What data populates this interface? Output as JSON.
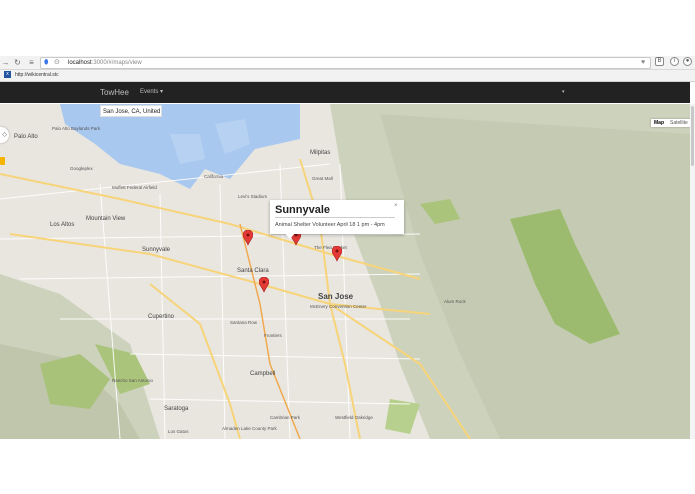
{
  "browser": {
    "url_host": "localhost",
    "url_path": ":3000/#/maps/view",
    "bookmark_label": "http://wikicentral.stc"
  },
  "navbar": {
    "brand": "TowHee",
    "events_label": "Events",
    "events_caret": "▾",
    "right_caret": "▾"
  },
  "map": {
    "search_value": "San Jose, CA, United S",
    "map_type_map": "Map",
    "map_type_satellite": "Satellite",
    "labels": {
      "palo_alto": "Palo Alto",
      "palo_alto_baylands": "Palo Alto Baylands Park",
      "milpitas": "Milpitas",
      "mountain_view": "Mountain View",
      "los_altos": "Los Altos",
      "sunnyvale": "Sunnyvale",
      "santa_clara": "Santa Clara",
      "san_jose": "San Jose",
      "cupertino": "Cupertino",
      "campbell": "Campbell",
      "saratoga": "Saratoga",
      "moffett": "Moffett Federal Airfield",
      "googleplex": "Googleplex",
      "great_mall": "Great Mall",
      "flea_market": "The Flea Market",
      "mcenery": "McEnery Convention Center",
      "frontiers": "Frontiers",
      "santana_row": "Santana Row",
      "cambrian_park": "Cambrian Park",
      "westfield_oakridge": "Westfield Oakridge",
      "almaden_lake_park": "Almaden Lake County Park",
      "levis_stadium": "Levi's Stadium",
      "rancho_san_antonio": "Rancho San Antonio",
      "alum_rock": "Alum Rock",
      "los_gatos": "Los Gatos",
      "california": "California"
    }
  },
  "info_window": {
    "title": "Sunnyvale",
    "body": "Animal Shelter Volunteer April 18 1 pm - 4pm",
    "close": "×"
  },
  "colors": {
    "navbar_bg": "#222222",
    "marker": "#e53935",
    "water": "#a8c8ef",
    "park": "#c5dea5",
    "hills": "#cfd4c0"
  },
  "icons": {
    "back": "arrow-right-icon",
    "reload": "reload-icon",
    "location": "location-pin-icon",
    "shield": "shield-icon",
    "heart": "heart-icon",
    "extension": "extension-icon",
    "info": "info-icon",
    "user": "user-icon"
  }
}
